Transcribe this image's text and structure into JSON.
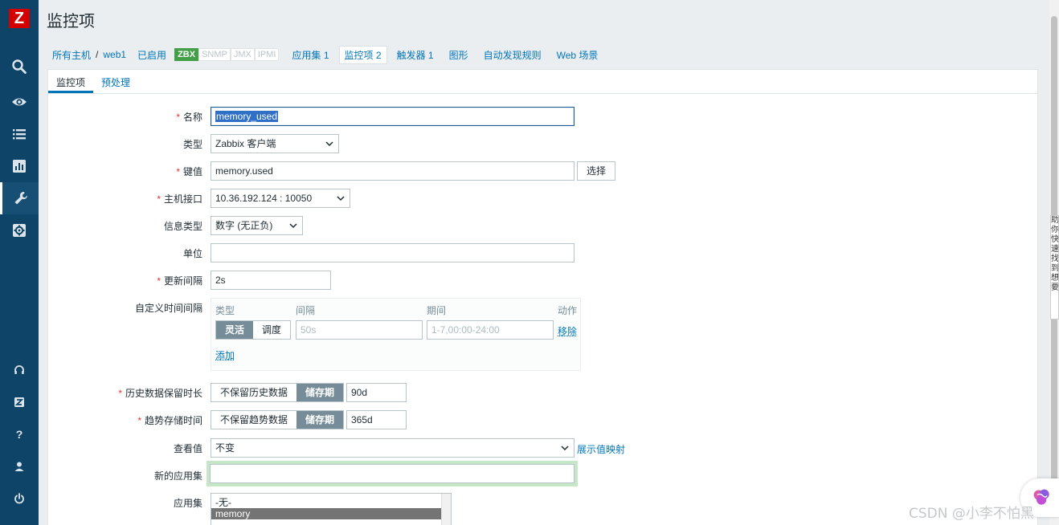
{
  "app": {
    "logo_letter": "Z",
    "page_title": "监控项"
  },
  "sidebar": {
    "items": [
      {
        "icon": "search-icon"
      },
      {
        "icon": "eye-icon"
      },
      {
        "icon": "list-icon"
      },
      {
        "icon": "chart-icon"
      },
      {
        "icon": "wrench-icon",
        "active": true
      },
      {
        "icon": "gear-icon"
      }
    ],
    "bottom": [
      {
        "icon": "headset-icon"
      },
      {
        "icon": "zabbix-share-icon",
        "label": "Z"
      },
      {
        "icon": "help-icon",
        "label": "?"
      },
      {
        "icon": "user-icon"
      },
      {
        "icon": "power-icon"
      }
    ]
  },
  "breadcrumbs": {
    "all_hosts": "所有主机",
    "separator": "/",
    "host": "web1",
    "status": "已启用",
    "interfaces": [
      "ZBX",
      "SNMP",
      "JMX",
      "IPMI"
    ],
    "tabs": [
      {
        "label": "应用集",
        "count": "1"
      },
      {
        "label": "监控项",
        "count": "2",
        "active": true
      },
      {
        "label": "触发器",
        "count": "1"
      },
      {
        "label": "图形",
        "count": ""
      },
      {
        "label": "自动发现规则",
        "count": ""
      },
      {
        "label": "Web 场景",
        "count": ""
      }
    ]
  },
  "subtabs": [
    "监控项",
    "预处理"
  ],
  "form": {
    "name": {
      "label": "名称",
      "value": "memory_used"
    },
    "type": {
      "label": "类型",
      "value": "Zabbix 客户端"
    },
    "key": {
      "label": "键值",
      "value": "memory.used",
      "button": "选择"
    },
    "interface": {
      "label": "主机接口",
      "value": "10.36.192.124 : 10050"
    },
    "info_type": {
      "label": "信息类型",
      "value": "数字 (无正负)"
    },
    "units": {
      "label": "单位",
      "value": ""
    },
    "update_interval": {
      "label": "更新间隔",
      "value": "2s"
    },
    "custom_intervals": {
      "label": "自定义时间间隔",
      "headers": {
        "type": "类型",
        "interval": "间隔",
        "period": "期间",
        "action": "动作"
      },
      "type_options": [
        "灵活",
        "调度"
      ],
      "interval_placeholder": "50s",
      "period_placeholder": "1-7,00:00-24:00",
      "remove": "移除",
      "add": "添加"
    },
    "history": {
      "label": "历史数据保留时长",
      "options": [
        "不保留历史数据",
        "储存期"
      ],
      "value": "90d"
    },
    "trends": {
      "label": "趋势存储时间",
      "options": [
        "不保留趋势数据",
        "储存期"
      ],
      "value": "365d"
    },
    "show_value": {
      "label": "查看值",
      "value": "不变",
      "link": "展示值映射"
    },
    "new_application": {
      "label": "新的应用集",
      "value": ""
    },
    "applications": {
      "label": "应用集",
      "options": [
        "-无-",
        "memory"
      ],
      "selected": "memory"
    }
  },
  "overlay": {
    "side_text": "助你快速找到想要",
    "watermark": "CSDN @小李不怕黑"
  },
  "colors": {
    "sidebar": "#0e4468",
    "link": "#0275b8",
    "status_green": "#429e47",
    "required": "#e33734"
  }
}
